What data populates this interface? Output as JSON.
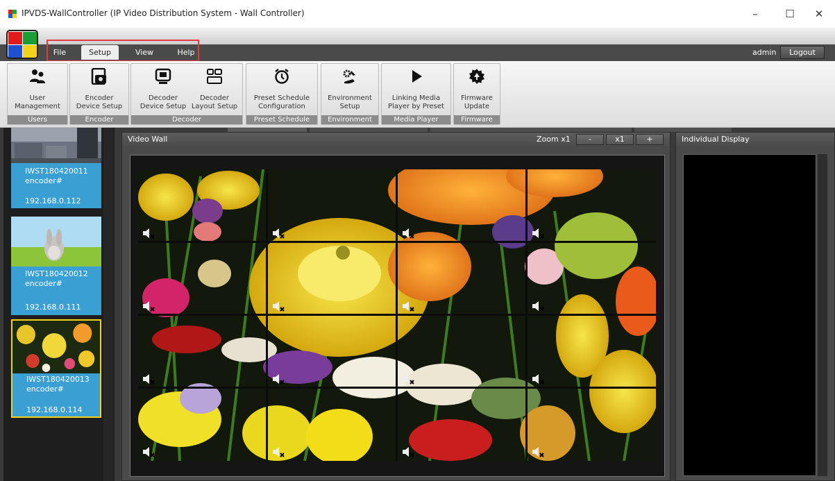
{
  "window": {
    "title": "IPVDS-WallController (IP Video Distribution System - Wall Controller)",
    "minimize_glyph": "–",
    "maximize_glyph": "☐",
    "close_glyph": "✕"
  },
  "menubar": {
    "items": [
      {
        "label": "File"
      },
      {
        "label": "Setup",
        "active": true
      },
      {
        "label": "View"
      },
      {
        "label": "Help"
      }
    ],
    "user": "admin",
    "logout_label": "Logout"
  },
  "ribbon": {
    "groups": [
      {
        "footer": "Users",
        "buttons": [
          {
            "line1": "User",
            "line2": "Management",
            "icon": "users-icon"
          }
        ]
      },
      {
        "footer": "Encoder",
        "buttons": [
          {
            "line1": "Encoder",
            "line2": "Device Setup",
            "icon": "encoder-camera-icon"
          }
        ]
      },
      {
        "footer": "Decoder",
        "buttons": [
          {
            "line1": "Decoder",
            "line2": "Device Setup",
            "icon": "decoder-monitor-icon"
          },
          {
            "line1": "Decoder",
            "line2": "Layout Setup",
            "icon": "layout-grid-icon"
          }
        ]
      },
      {
        "footer": "Preset Schedule",
        "buttons": [
          {
            "line1": "Preset Schedule",
            "line2": "Configuration",
            "icon": "alarm-clock-icon"
          }
        ]
      },
      {
        "footer": "Environment",
        "buttons": [
          {
            "line1": "Environment",
            "line2": "Setup",
            "icon": "tools-gear-icon"
          }
        ]
      },
      {
        "footer": "Media Player",
        "buttons": [
          {
            "line1": "Linking Media",
            "line2": "Player by Preset",
            "icon": "play-icon"
          }
        ]
      },
      {
        "footer": "Firmware",
        "buttons": [
          {
            "line1": "Firmware",
            "line2": "Update",
            "icon": "firmware-gear-icon"
          }
        ]
      }
    ]
  },
  "encoders": [
    {
      "name": "IWST180420011",
      "type": "encoder#",
      "ip": "192.168.0.112",
      "selected": false
    },
    {
      "name": "IWST180420012",
      "type": "encoder#",
      "ip": "192.168.0.111",
      "selected": false
    },
    {
      "name": "IWST180420013",
      "type": "encoder#",
      "ip": "192.168.0.114",
      "selected": true
    }
  ],
  "video_wall": {
    "title": "Video Wall",
    "zoom_label": "Zoom x1",
    "zoom_minus": "-",
    "zoom_value": "x1",
    "zoom_plus": "+",
    "rows": 4,
    "cols": 4,
    "cell_icon": "speaker-muted-icon"
  },
  "individual_display": {
    "title": "Individual Display"
  },
  "colors": {
    "menubar_bg": "#4a4a4a",
    "highlight": "#e53a44",
    "encoder_card": "#3aa0d4",
    "selected_border": "#f2d21c",
    "panel_bg": "#4a4a4a"
  }
}
